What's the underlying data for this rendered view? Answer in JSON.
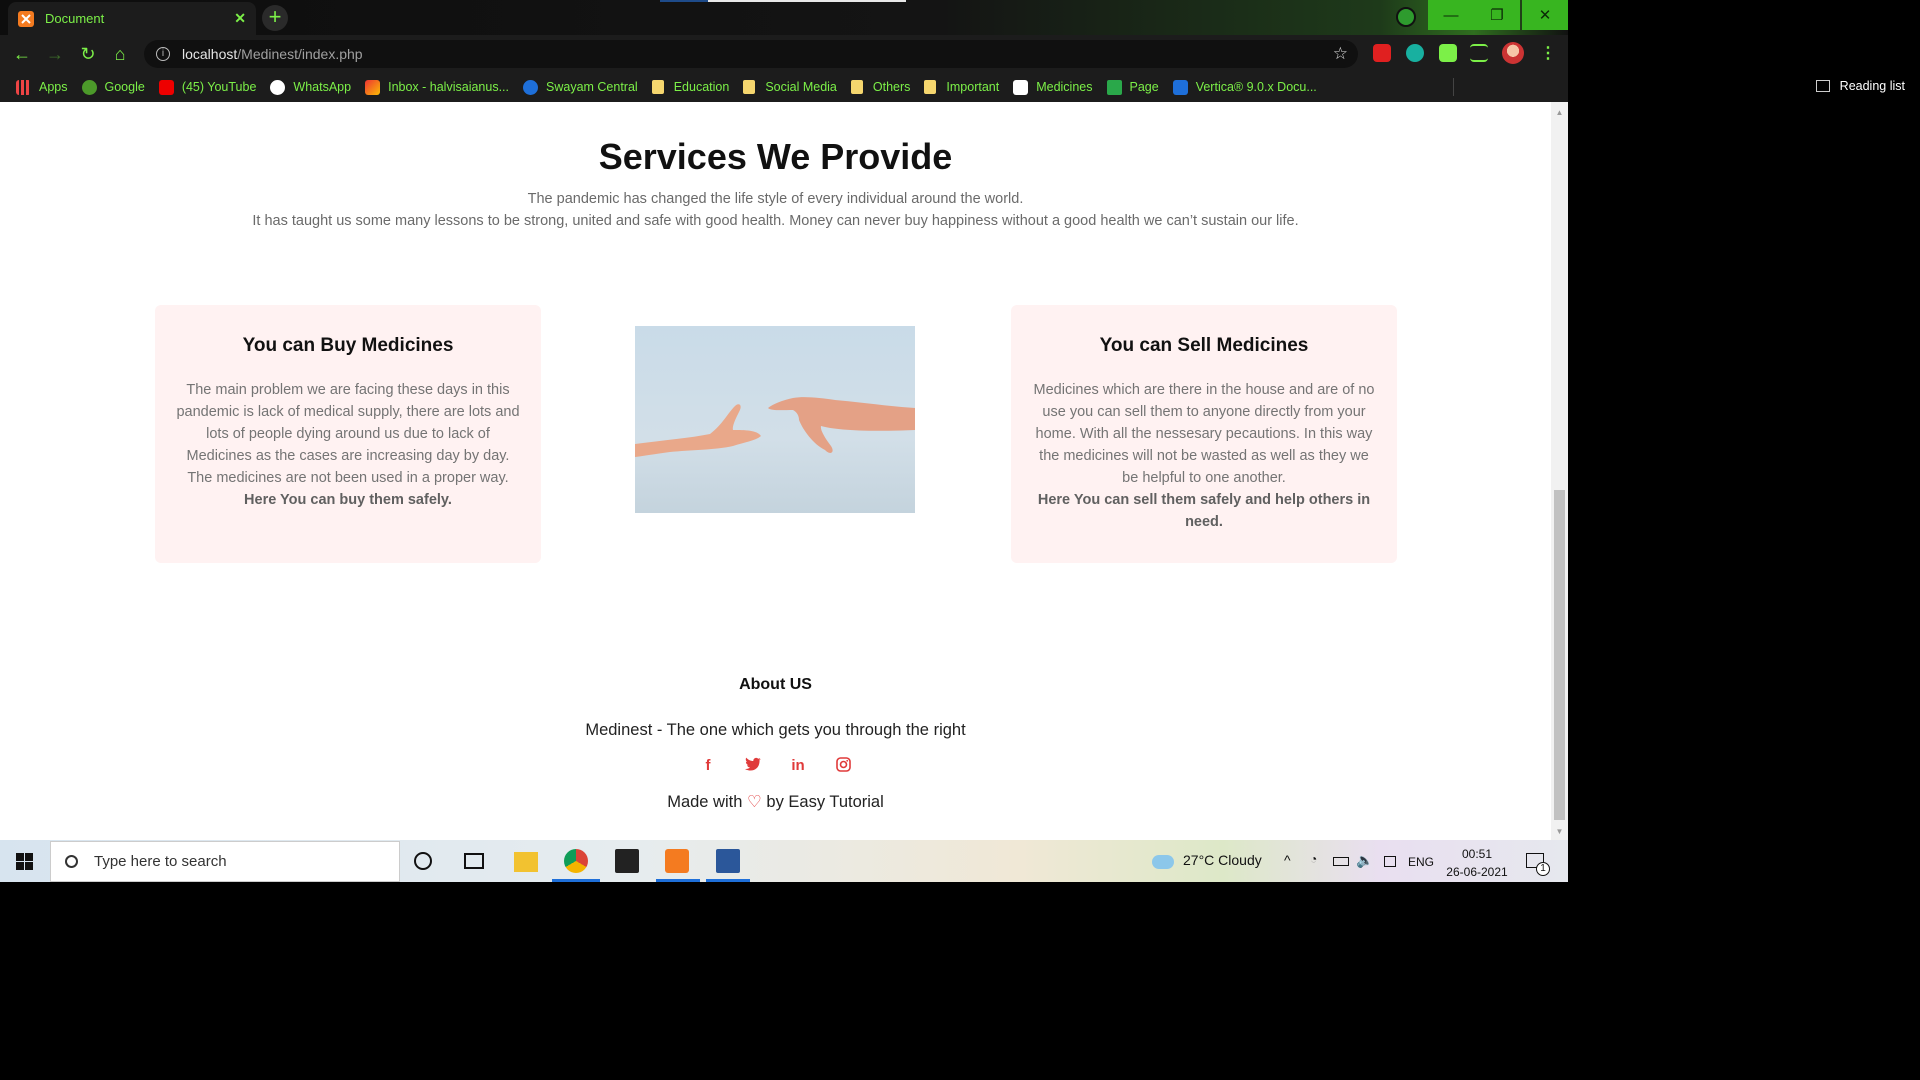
{
  "browser": {
    "tab_title": "Document",
    "url_host": "localhost",
    "url_path": "/Medinest/index.php",
    "bookmarks": [
      "Apps",
      "Google",
      "(45) YouTube",
      "WhatsApp",
      "Inbox - halvisaianus...",
      "Swayam Central",
      "Education",
      "Social Media",
      "Others",
      "Important",
      "Medicines",
      "Page",
      "Vertica® 9.0.x Docu..."
    ],
    "reading_list": "Reading list"
  },
  "services": {
    "title": "Services We Provide",
    "intro_line1": "The pandemic has changed the life style of every individual around the world.",
    "intro_line2": "It has taught us some many lessons to be strong, united and safe with good health. Money can never buy happiness without a good health we can’t sustain our life.",
    "buy": {
      "title": "You can Buy Medicines",
      "body": "The main problem we are facing these days in this pandemic is lack of medical supply, there are lots and lots of people dying around us due to lack of Medicines as the cases are increasing day by day. The medicines are not been used in a proper way.",
      "bold": "Here You can buy them safely."
    },
    "sell": {
      "title": "You can Sell Medicines",
      "body": "Medicines which are there in the house and are of no use you can sell them to anyone directly from your home. With all the nessesary pecautions. In this way the medicines will not be wasted as well as they we be helpful to one another.",
      "bold": "Here You can sell them safely and help others in need."
    }
  },
  "about": {
    "title": "About US",
    "tagline": "Medinest - The one which gets you through the right",
    "made_prefix": "Made with",
    "made_suffix": "by Easy Tutorial"
  },
  "taskbar": {
    "search_placeholder": "Type here to search",
    "weather": "27°C  Cloudy",
    "lang": "ENG",
    "time": "00:51",
    "date": "26-06-2021",
    "notifications": "1"
  },
  "colors": {
    "accent_green": "#7cf048",
    "social_red": "#e03a3a",
    "card_bg": "#fff2f2"
  }
}
